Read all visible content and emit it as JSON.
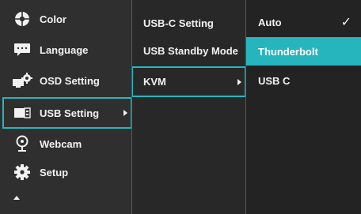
{
  "main_menu": {
    "items": [
      {
        "label": "Color",
        "icon": "color-wheel-icon"
      },
      {
        "label": "Language",
        "icon": "language-icon"
      },
      {
        "label": "OSD Setting",
        "icon": "osd-setting-icon"
      },
      {
        "label": "USB Setting",
        "icon": "usb-setting-icon"
      },
      {
        "label": "Webcam",
        "icon": "webcam-icon"
      },
      {
        "label": "Setup",
        "icon": "setup-gear-icon"
      }
    ],
    "active_index": 3
  },
  "submenu": {
    "items": [
      {
        "label": "USB-C Setting"
      },
      {
        "label": "USB Standby Mode"
      },
      {
        "label": "KVM"
      }
    ],
    "active_index": 2
  },
  "options": {
    "items": [
      {
        "label": "Auto",
        "checked": true
      },
      {
        "label": "Thunderbolt",
        "checked": false
      },
      {
        "label": "USB C",
        "checked": false
      }
    ],
    "highlighted_index": 1
  },
  "glyphs": {
    "check": "✓"
  },
  "colors": {
    "accent": "#26b4bd",
    "background": "#2b2b2b",
    "text": "#f2f2f2"
  }
}
